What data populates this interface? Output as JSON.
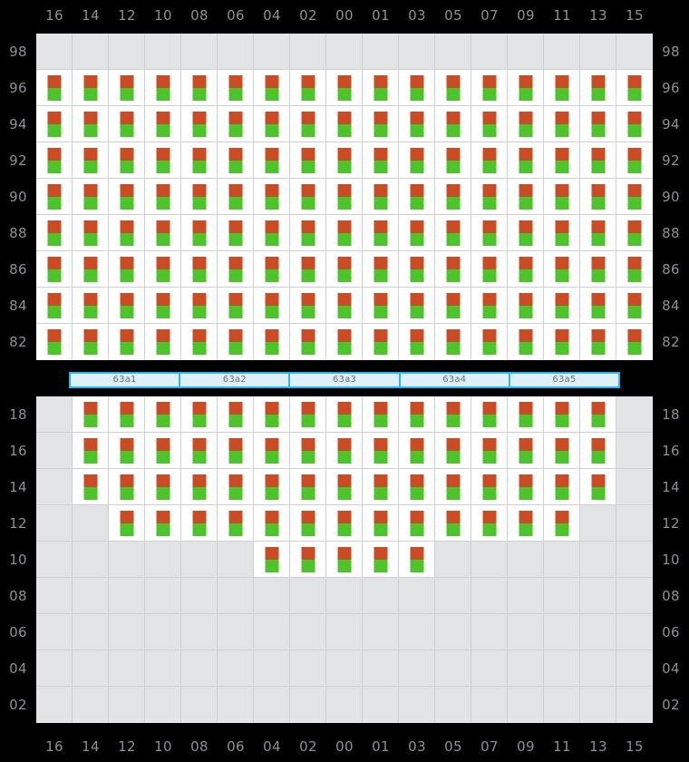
{
  "colors": {
    "page_background": "#000000",
    "grid_empty": "#e3e4e6",
    "grid_line": "#cfd0d2",
    "seat_background": "#ffffff",
    "seat_top": "#cc4b27",
    "seat_bottom": "#4cc42a",
    "axis_text": "#8d9096",
    "zone_border": "#29b6f6",
    "zone_fill": "#def1fb",
    "zone_text": "#6a6e75"
  },
  "axes": {
    "columns": [
      "16",
      "14",
      "12",
      "10",
      "08",
      "06",
      "04",
      "02",
      "00",
      "01",
      "03",
      "05",
      "07",
      "09",
      "11",
      "13",
      "15"
    ],
    "upper_rows": [
      "98",
      "96",
      "94",
      "92",
      "90",
      "88",
      "86",
      "84",
      "82"
    ],
    "lower_rows": [
      "18",
      "16",
      "14",
      "12",
      "10",
      "08",
      "06",
      "04",
      "02"
    ]
  },
  "zone_bar": {
    "segments": [
      {
        "label": "63a1"
      },
      {
        "label": "63a2"
      },
      {
        "label": "63a3"
      },
      {
        "label": "63a4"
      },
      {
        "label": "63a5"
      }
    ]
  },
  "seat_icon": {
    "name": "seat-marker",
    "top_segment": "backrest",
    "bottom_segment": "cushion"
  },
  "upper_section": {
    "name": "upper-seat-block",
    "rows": [
      {
        "label": "98",
        "occupancy": [
          0,
          0,
          0,
          0,
          0,
          0,
          0,
          0,
          0,
          0,
          0,
          0,
          0,
          0,
          0,
          0,
          0
        ]
      },
      {
        "label": "96",
        "occupancy": [
          1,
          1,
          1,
          1,
          1,
          1,
          1,
          1,
          1,
          1,
          1,
          1,
          1,
          1,
          1,
          1,
          1
        ]
      },
      {
        "label": "94",
        "occupancy": [
          1,
          1,
          1,
          1,
          1,
          1,
          1,
          1,
          1,
          1,
          1,
          1,
          1,
          1,
          1,
          1,
          1
        ]
      },
      {
        "label": "92",
        "occupancy": [
          1,
          1,
          1,
          1,
          1,
          1,
          1,
          1,
          1,
          1,
          1,
          1,
          1,
          1,
          1,
          1,
          1
        ]
      },
      {
        "label": "90",
        "occupancy": [
          1,
          1,
          1,
          1,
          1,
          1,
          1,
          1,
          1,
          1,
          1,
          1,
          1,
          1,
          1,
          1,
          1
        ]
      },
      {
        "label": "88",
        "occupancy": [
          1,
          1,
          1,
          1,
          1,
          1,
          1,
          1,
          1,
          1,
          1,
          1,
          1,
          1,
          1,
          1,
          1
        ]
      },
      {
        "label": "86",
        "occupancy": [
          1,
          1,
          1,
          1,
          1,
          1,
          1,
          1,
          1,
          1,
          1,
          1,
          1,
          1,
          1,
          1,
          1
        ]
      },
      {
        "label": "84",
        "occupancy": [
          1,
          1,
          1,
          1,
          1,
          1,
          1,
          1,
          1,
          1,
          1,
          1,
          1,
          1,
          1,
          1,
          1
        ]
      },
      {
        "label": "82",
        "occupancy": [
          1,
          1,
          1,
          1,
          1,
          1,
          1,
          1,
          1,
          1,
          1,
          1,
          1,
          1,
          1,
          1,
          1
        ]
      }
    ]
  },
  "lower_section": {
    "name": "lower-seat-block",
    "rows": [
      {
        "label": "18",
        "occupancy": [
          0,
          1,
          1,
          1,
          1,
          1,
          1,
          1,
          1,
          1,
          1,
          1,
          1,
          1,
          1,
          1,
          0
        ]
      },
      {
        "label": "16",
        "occupancy": [
          0,
          1,
          1,
          1,
          1,
          1,
          1,
          1,
          1,
          1,
          1,
          1,
          1,
          1,
          1,
          1,
          0
        ]
      },
      {
        "label": "14",
        "occupancy": [
          0,
          1,
          1,
          1,
          1,
          1,
          1,
          1,
          1,
          1,
          1,
          1,
          1,
          1,
          1,
          1,
          0
        ]
      },
      {
        "label": "12",
        "occupancy": [
          0,
          0,
          1,
          1,
          1,
          1,
          1,
          1,
          1,
          1,
          1,
          1,
          1,
          1,
          1,
          0,
          0
        ]
      },
      {
        "label": "10",
        "occupancy": [
          0,
          0,
          0,
          0,
          0,
          0,
          1,
          1,
          1,
          1,
          1,
          0,
          0,
          0,
          0,
          0,
          0
        ]
      },
      {
        "label": "08",
        "occupancy": [
          0,
          0,
          0,
          0,
          0,
          0,
          0,
          0,
          0,
          0,
          0,
          0,
          0,
          0,
          0,
          0,
          0
        ]
      },
      {
        "label": "06",
        "occupancy": [
          0,
          0,
          0,
          0,
          0,
          0,
          0,
          0,
          0,
          0,
          0,
          0,
          0,
          0,
          0,
          0,
          0
        ]
      },
      {
        "label": "04",
        "occupancy": [
          0,
          0,
          0,
          0,
          0,
          0,
          0,
          0,
          0,
          0,
          0,
          0,
          0,
          0,
          0,
          0,
          0
        ]
      },
      {
        "label": "02",
        "occupancy": [
          0,
          0,
          0,
          0,
          0,
          0,
          0,
          0,
          0,
          0,
          0,
          0,
          0,
          0,
          0,
          0,
          0
        ]
      }
    ]
  }
}
